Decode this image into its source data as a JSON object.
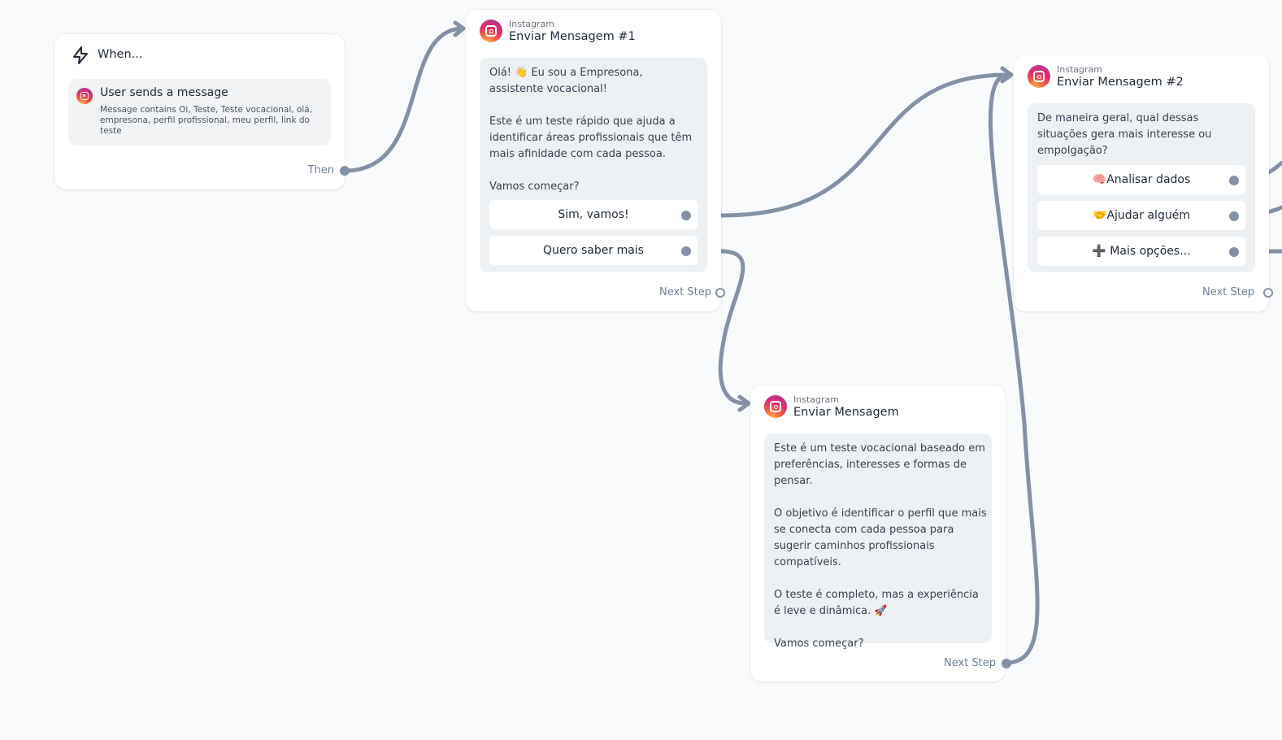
{
  "trigger": {
    "title": "When...",
    "event_title": "User sends a message",
    "event_desc": "Message contains Oi, Teste, Teste vocacional, olá, empresona, perfil profissional, meu perfil, link do teste",
    "then_label": "Then"
  },
  "node1": {
    "platform": "Instagram",
    "title": "Enviar Mensagem #1",
    "message": "Olá! 👋 Eu sou a Empresona, assistente vocacional!\n\nEste é um teste rápido que ajuda a identificar áreas profissionais que têm mais afinidade com cada pessoa.\n\nVamos começar?",
    "buttons": [
      "Sim, vamos!",
      "Quero saber mais"
    ],
    "next_label": "Next Step"
  },
  "node2": {
    "platform": "Instagram",
    "title": "Enviar Mensagem #2",
    "message": "De maneira geral, qual dessas situações gera mais interesse ou empolgação?",
    "buttons": [
      "🧠Analisar dados",
      "🤝Ajudar alguém",
      "➕ Mais opções..."
    ],
    "next_label": "Next Step"
  },
  "node3": {
    "platform": "Instagram",
    "title": "Enviar Mensagem",
    "message": "Este é um teste vocacional baseado em preferências, interesses e formas de pensar.\n\nO objetivo é identificar o perfil que mais se conecta com cada pessoa para sugerir caminhos profissionais compatíveis.\n\nO teste é completo, mas a experiência é leve e dinâmica. 🚀\n\nVamos começar?",
    "next_label": "Next Step"
  },
  "colors": {
    "canvas": "#f8fafc",
    "edge": "#8491a5",
    "bubble": "#eef1f4"
  }
}
